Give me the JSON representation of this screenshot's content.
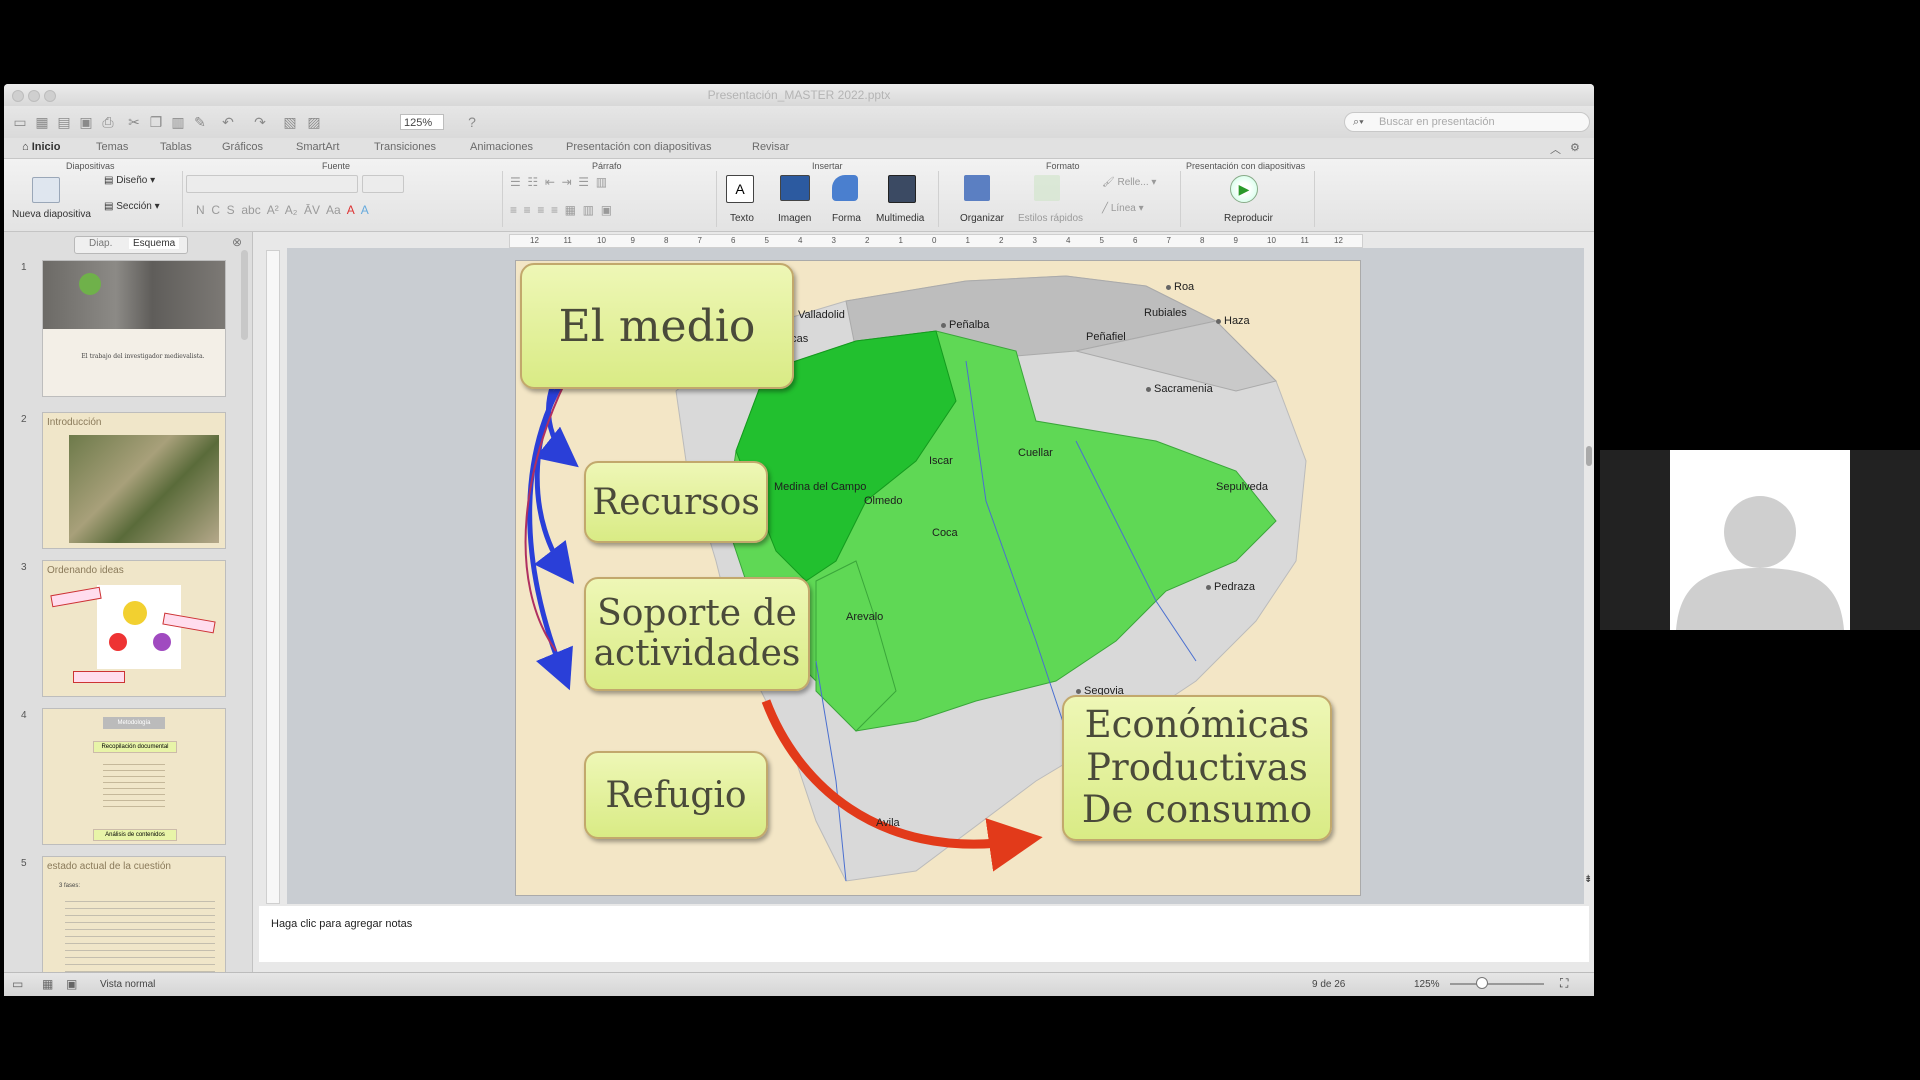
{
  "window": {
    "title": "Presentación_MASTER 2022.pptx"
  },
  "toolbar": {
    "zoom": "125%",
    "search_placeholder": "Buscar en presentación"
  },
  "tabs": [
    "Inicio",
    "Temas",
    "Tablas",
    "Gráficos",
    "SmartArt",
    "Transiciones",
    "Animaciones",
    "Presentación con diapositivas",
    "Revisar"
  ],
  "ribbon": {
    "groups": {
      "diapositivas": "Diapositivas",
      "fuente": "Fuente",
      "parrafo": "Párrafo",
      "insertar": "Insertar",
      "formato": "Formato",
      "presentacion": "Presentación con diapositivas"
    },
    "nueva_diapositiva": "Nueva diapositiva",
    "diseno": "Diseño",
    "seccion": "Sección",
    "texto": "Texto",
    "imagen": "Imagen",
    "forma": "Forma",
    "multimedia": "Multimedia",
    "organizar": "Organizar",
    "estilos_rapidos": "Estilos rápidos",
    "relleno": "Relle...",
    "linea": "Línea",
    "reproducir": "Reproducir"
  },
  "sidebar": {
    "tab_diap": "Diap.",
    "tab_esquema": "Esquema",
    "slides": [
      {
        "num": "1",
        "title": "",
        "caption": "El trabajo del investigador medievalista."
      },
      {
        "num": "2",
        "title": "Introducción"
      },
      {
        "num": "3",
        "title": "Ordenando ideas"
      },
      {
        "num": "4",
        "title": "Metodología",
        "items": [
          "Recopilación documental",
          "Análisis de contenidos"
        ]
      },
      {
        "num": "5",
        "title": "estado actual de la cuestión",
        "subtitle": "3 fases:"
      }
    ]
  },
  "ruler": {
    "ticks": [
      "12",
      "11",
      "10",
      "9",
      "8",
      "7",
      "6",
      "5",
      "4",
      "3",
      "2",
      "1",
      "0",
      "1",
      "2",
      "3",
      "4",
      "5",
      "6",
      "7",
      "8",
      "9",
      "10",
      "11",
      "12"
    ]
  },
  "slide": {
    "boxes": {
      "medio": "El medio",
      "recursos": "Recursos",
      "soporte_l1": "Soporte de",
      "soporte_l2": "actividades",
      "refugio": "Refugio",
      "eco_l1": "Económicas",
      "eco_l2": "Productivas",
      "eco_l3": "De consumo"
    },
    "towns": [
      "Roa",
      "Valladolid",
      "Peñalba",
      "Rubiales",
      "Haza",
      "Simancas",
      "Peñafiel",
      "Sacramenia",
      "Iscar",
      "Cuellar",
      "Medina del Campo",
      "Olmedo",
      "Sepulveda",
      "Coca",
      "Pedraza",
      "Arevalo",
      "Segovia",
      "Avila"
    ],
    "colors": {
      "dark_green": "#22c02f",
      "light_green": "#5fd855",
      "arrow_blue": "#2a3fd8",
      "arrow_red": "#e23a1a"
    }
  },
  "notes": {
    "placeholder": "Haga clic para agregar notas"
  },
  "status": {
    "view": "Vista normal",
    "page": "9 de 26",
    "zoom": "125%"
  }
}
